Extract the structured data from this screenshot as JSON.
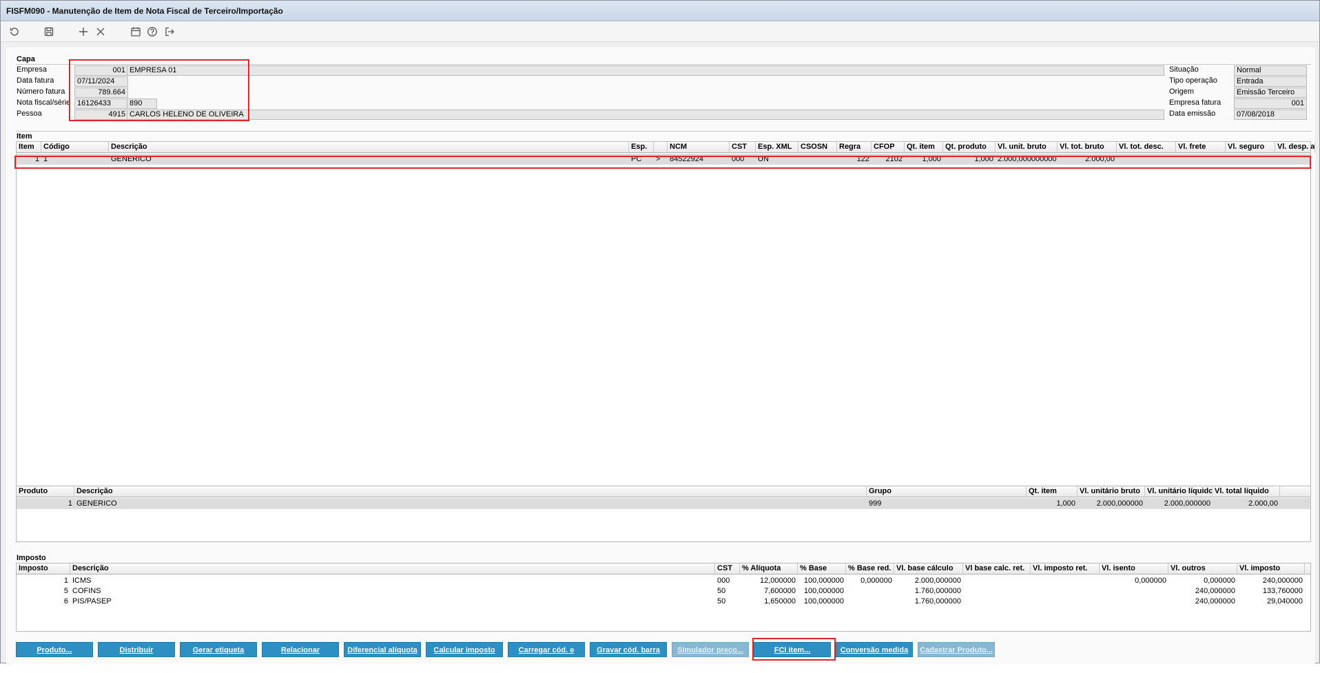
{
  "window": {
    "title": "FISFM090 - Manutenção de Item de Nota Fiscal de Terceiro/Importação"
  },
  "toolbar": {
    "icons": [
      "refresh-icon",
      "save-icon",
      "add-icon",
      "delete-icon",
      "calendar-icon",
      "help-icon",
      "exit-icon"
    ]
  },
  "capa": {
    "title": "Capa",
    "empresa_label": "Empresa",
    "empresa_code": "001",
    "empresa_name": "EMPRESA 01",
    "data_fatura_label": "Data fatura",
    "data_fatura": "07/11/2024",
    "numero_fatura_label": "Número fatura",
    "numero_fatura": "789.664",
    "nota_label": "Nota fiscal/série",
    "nota_numero": "16126433",
    "nota_serie": "890",
    "pessoa_label": "Pessoa",
    "pessoa_code": "4915",
    "pessoa_name": "CARLOS HELENO DE OLIVEIRA",
    "situacao_label": "Situação",
    "situacao": "Normal",
    "tipo_operacao_label": "Tipo operação",
    "tipo_operacao": "Entrada",
    "origem_label": "Origem",
    "origem": "Emissão Terceiro",
    "empresa_fatura_label": "Empresa fatura",
    "empresa_fatura": "001",
    "data_emissao_label": "Data emissão",
    "data_emissao": "07/08/2018"
  },
  "item": {
    "title": "Item",
    "columns": [
      "Item",
      "Código",
      "Descrição",
      "Esp.",
      "",
      "NCM",
      "CST",
      "Esp. XML",
      "CSOSN",
      "Regra",
      "CFOP",
      "Qt. item",
      "Qt. produto",
      "Vl. unit. bruto",
      "Vl. tot. bruto",
      "Vl. tot. desc.",
      "Vl. frete",
      "Vl. seguro",
      "Vl. desp. ac."
    ],
    "rows": [
      [
        "1",
        "1",
        "GENERICO",
        "PC",
        ">",
        "84522924",
        "000",
        "UN",
        "",
        "122",
        "2102",
        "1,000",
        "1,000",
        "2.000,000000000",
        "2.000,00",
        "",
        "",
        "",
        ""
      ]
    ]
  },
  "produto": {
    "columns": [
      "Produto",
      "Descrição",
      "Grupo",
      "Qt. item",
      "Vl. unitário bruto",
      "Vl. unitário líquido",
      "Vl. total líquido"
    ],
    "rows": [
      [
        "1",
        "GENERICO",
        "999",
        "1,000",
        "2.000,000000",
        "2.000,000000",
        "2.000,00"
      ]
    ]
  },
  "imposto": {
    "title": "Imposto",
    "columns": [
      "Imposto",
      "Descrição",
      "CST",
      "% Alíquota",
      "% Base",
      "% Base red.",
      "Vl. base cálculo",
      "Vl base calc. ret.",
      "Vl. imposto ret.",
      "Vl. isento",
      "Vl. outros",
      "Vl. imposto"
    ],
    "rows": [
      [
        "1",
        "ICMS",
        "000",
        "12,000000",
        "100,000000",
        "0,000000",
        "2.000,000000",
        "",
        "",
        "0,000000",
        "0,000000",
        "240,000000"
      ],
      [
        "5",
        "COFINS",
        "50",
        "7,600000",
        "100,000000",
        "",
        "1.760,000000",
        "",
        "",
        "",
        "240,000000",
        "133,760000"
      ],
      [
        "6",
        "PIS/PASEP",
        "50",
        "1,650000",
        "100,000000",
        "",
        "1.760,000000",
        "",
        "",
        "",
        "240,000000",
        "29,040000"
      ]
    ]
  },
  "buttons": [
    {
      "label": "Produto...",
      "enabled": true
    },
    {
      "label": "Distribuir",
      "enabled": true
    },
    {
      "label": "Gerar etiqueta",
      "enabled": true
    },
    {
      "label": "Relacionar",
      "enabled": true
    },
    {
      "label": "Diferencial alíquota",
      "enabled": true
    },
    {
      "label": "Calcular imposto",
      "enabled": true
    },
    {
      "label": "Carregar cód. e desc.",
      "enabled": true
    },
    {
      "label": "Gravar cód. barra",
      "enabled": true
    },
    {
      "label": "Simulador preço...",
      "enabled": false
    },
    {
      "label": "FCI item...",
      "enabled": true
    },
    {
      "label": "Conversão medida",
      "enabled": true
    },
    {
      "label": "Cadastrar Produto...",
      "enabled": false
    }
  ],
  "colors": {
    "button": "#2e8fc3",
    "button_disabled": "#87b7d3",
    "highlight": "#e0262b"
  }
}
